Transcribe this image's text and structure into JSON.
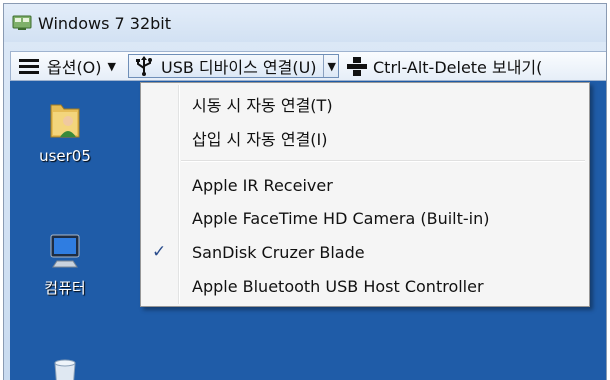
{
  "window": {
    "title": "Windows 7 32bit"
  },
  "toolbar": {
    "options_label": "옵션(O)",
    "usb_label": "USB 디바이스 연결(U)",
    "cad_label": "Ctrl-Alt-Delete 보내기("
  },
  "desktop": {
    "icons": [
      {
        "label": "user05",
        "icon": "user-folder-icon"
      },
      {
        "label": "컴퓨터",
        "icon": "computer-icon"
      },
      {
        "label": "",
        "icon": "recycle-bin-icon"
      }
    ]
  },
  "usb_menu": {
    "items": [
      {
        "label": "시동 시 자동 연결(T)",
        "checked": false
      },
      {
        "label": "삽입 시 자동 연결(I)",
        "checked": false
      },
      {
        "label": "Apple IR Receiver",
        "checked": false
      },
      {
        "label": "Apple FaceTime HD Camera (Built-in)",
        "checked": false
      },
      {
        "label": "SanDisk Cruzer Blade",
        "checked": true
      },
      {
        "label": "Apple Bluetooth USB Host Controller",
        "checked": false
      }
    ],
    "check_mark": "✓"
  },
  "colors": {
    "desktop_bg": "#1f5ca8",
    "titlebar_bg": "#d2e1f3",
    "menu_bg": "#f5f5f5",
    "check_color": "#2b4d8c"
  }
}
